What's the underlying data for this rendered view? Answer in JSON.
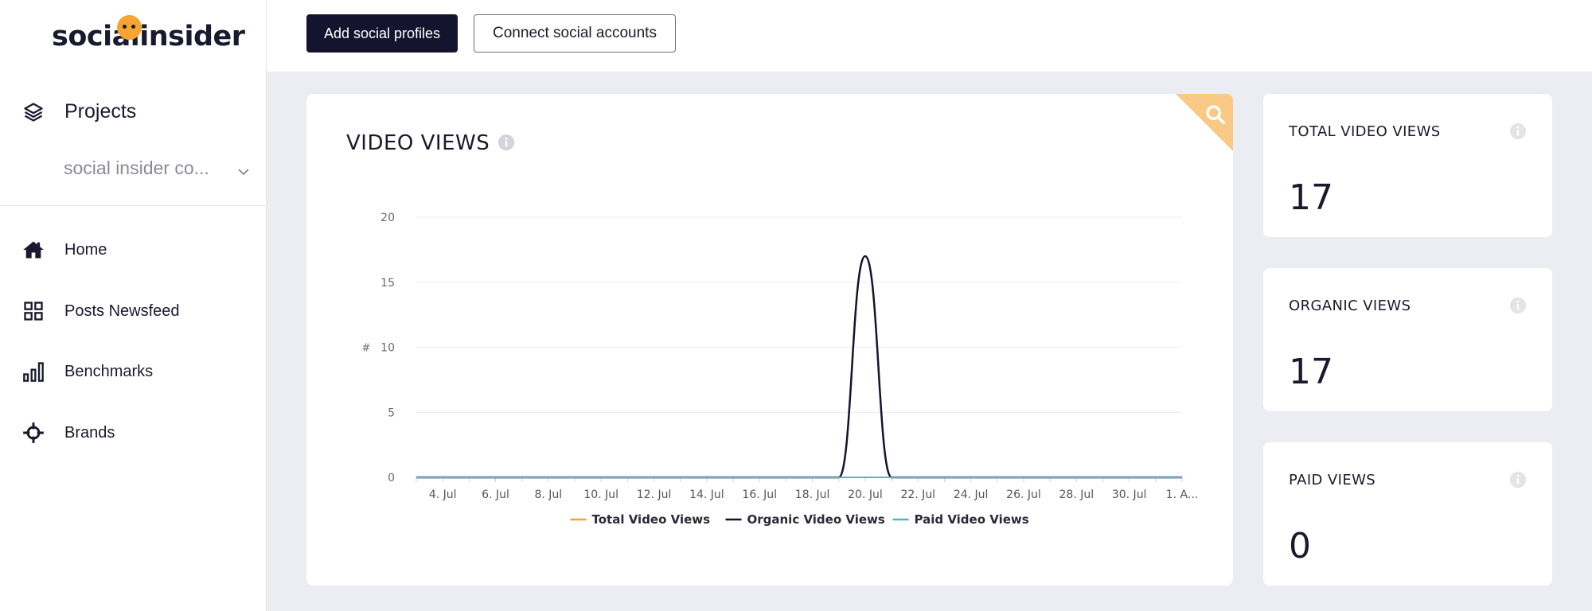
{
  "brand": {
    "logo_text": "socialinsider",
    "accent": "#f6a531"
  },
  "sidebar": {
    "projects_label": "Projects",
    "project_selected": "social insider co...",
    "items": [
      {
        "label": "Home",
        "icon": "home-icon"
      },
      {
        "label": "Posts Newsfeed",
        "icon": "grid-icon"
      },
      {
        "label": "Benchmarks",
        "icon": "bar-chart-icon"
      },
      {
        "label": "Brands",
        "icon": "crosshair-icon"
      }
    ]
  },
  "toolbar": {
    "add_profiles_label": "Add social profiles",
    "connect_accounts_label": "Connect social accounts"
  },
  "chart_card": {
    "title": "VIDEO VIEWS"
  },
  "chart_data": {
    "type": "line",
    "ylabel": "#",
    "ylim": [
      0,
      20
    ],
    "yticks": [
      0,
      5,
      10,
      15,
      20
    ],
    "x_tick_labels": [
      "4. Jul",
      "6. Jul",
      "8. Jul",
      "10. Jul",
      "12. Jul",
      "14. Jul",
      "16. Jul",
      "18. Jul",
      "20. Jul",
      "22. Jul",
      "24. Jul",
      "26. Jul",
      "28. Jul",
      "30. Jul",
      "1. A..."
    ],
    "x": [
      "3. Jul",
      "4. Jul",
      "5. Jul",
      "6. Jul",
      "7. Jul",
      "8. Jul",
      "9. Jul",
      "10. Jul",
      "11. Jul",
      "12. Jul",
      "13. Jul",
      "14. Jul",
      "15. Jul",
      "16. Jul",
      "17. Jul",
      "18. Jul",
      "19. Jul",
      "20. Jul",
      "21. Jul",
      "22. Jul",
      "23. Jul",
      "24. Jul",
      "25. Jul",
      "26. Jul",
      "27. Jul",
      "28. Jul",
      "29. Jul",
      "30. Jul",
      "31. Jul",
      "1. Aug"
    ],
    "series": [
      {
        "name": "Total Video Views",
        "color": "#f6a531",
        "values": [
          0,
          0,
          0,
          0,
          0,
          0,
          0,
          0,
          0,
          0,
          0,
          0,
          0,
          0,
          0,
          0,
          0,
          17,
          0,
          0,
          0,
          0,
          0,
          0,
          0,
          0,
          0,
          0,
          0,
          0
        ]
      },
      {
        "name": "Organic Video Views",
        "color": "#15142e",
        "values": [
          0,
          0,
          0,
          0,
          0,
          0,
          0,
          0,
          0,
          0,
          0,
          0,
          0,
          0,
          0,
          0,
          0,
          17,
          0,
          0,
          0,
          0,
          0,
          0,
          0,
          0,
          0,
          0,
          0,
          0
        ]
      },
      {
        "name": "Paid Video Views",
        "color": "#4fb8c4",
        "values": [
          0,
          0,
          0,
          0,
          0,
          0,
          0,
          0,
          0,
          0,
          0,
          0,
          0,
          0,
          0,
          0,
          0,
          0,
          0,
          0,
          0,
          0,
          0,
          0,
          0,
          0,
          0,
          0,
          0,
          0
        ]
      }
    ],
    "legend": "bottom-center",
    "grid": true
  },
  "stats": [
    {
      "label": "TOTAL VIDEO VIEWS",
      "value": "17"
    },
    {
      "label": "ORGANIC VIEWS",
      "value": "17"
    },
    {
      "label": "PAID VIEWS",
      "value": "0"
    }
  ]
}
